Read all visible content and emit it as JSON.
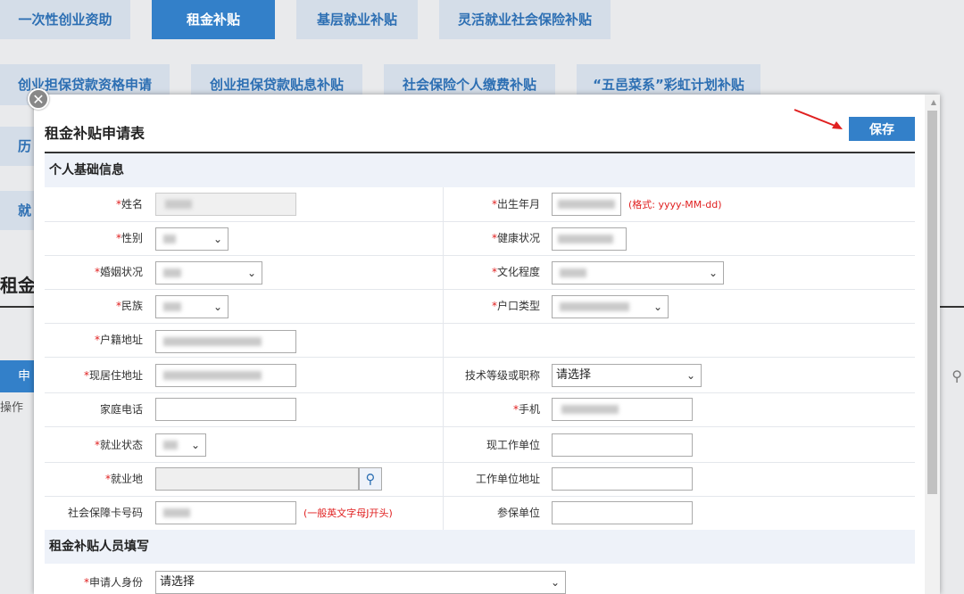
{
  "tabs": {
    "row1": [
      "一次性创业资助",
      "租金补贴",
      "基层就业补贴",
      "灵活就业社会保险补贴"
    ],
    "row2": [
      "创业担保贷款资格申请",
      "创业担保贷款贴息补贴",
      "社会保险个人缴费补贴",
      "“五邑菜系”彩虹计划补贴"
    ],
    "side_fragments": [
      "历",
      "就"
    ]
  },
  "background": {
    "heading": "租金",
    "bar_label": "申",
    "op_label": "操作"
  },
  "dialog": {
    "title": "租金补贴申请表",
    "save_label": "保存",
    "close_glyph": "✕",
    "sections": {
      "basic": "个人基础信息",
      "applicant": "租金补贴人员填写"
    },
    "labels": {
      "name": "姓名",
      "birth": "出生年月",
      "gender": "性别",
      "health": "健康状况",
      "marital": "婚姻状况",
      "education": "文化程度",
      "ethnicity": "民族",
      "hukou_type": "户口类型",
      "hukou_address": "户籍地址",
      "current_address": "现居住地址",
      "tech_level": "技术等级或职称",
      "home_phone": "家庭电话",
      "mobile": "手机",
      "employment_status": "就业状态",
      "work_unit": "现工作单位",
      "employment_place": "就业地",
      "work_address": "工作单位地址",
      "ssn": "社会保障卡号码",
      "insured_unit": "参保单位",
      "applicant_identity": "申请人身份"
    },
    "required_mark": "*",
    "hints": {
      "birth_format": "(格式: yyyy-MM-dd)",
      "ssn_format": "(一般英文字母J开头)"
    },
    "select_values": {
      "tech_level": "请选择",
      "applicant_identity": "请选择"
    },
    "icons": {
      "search": "search-icon",
      "chevron": "chevron-down-icon",
      "close": "close-icon"
    },
    "colors": {
      "accent": "#3380c9",
      "required": "#e02020",
      "section_bg": "#eef2f9"
    }
  }
}
